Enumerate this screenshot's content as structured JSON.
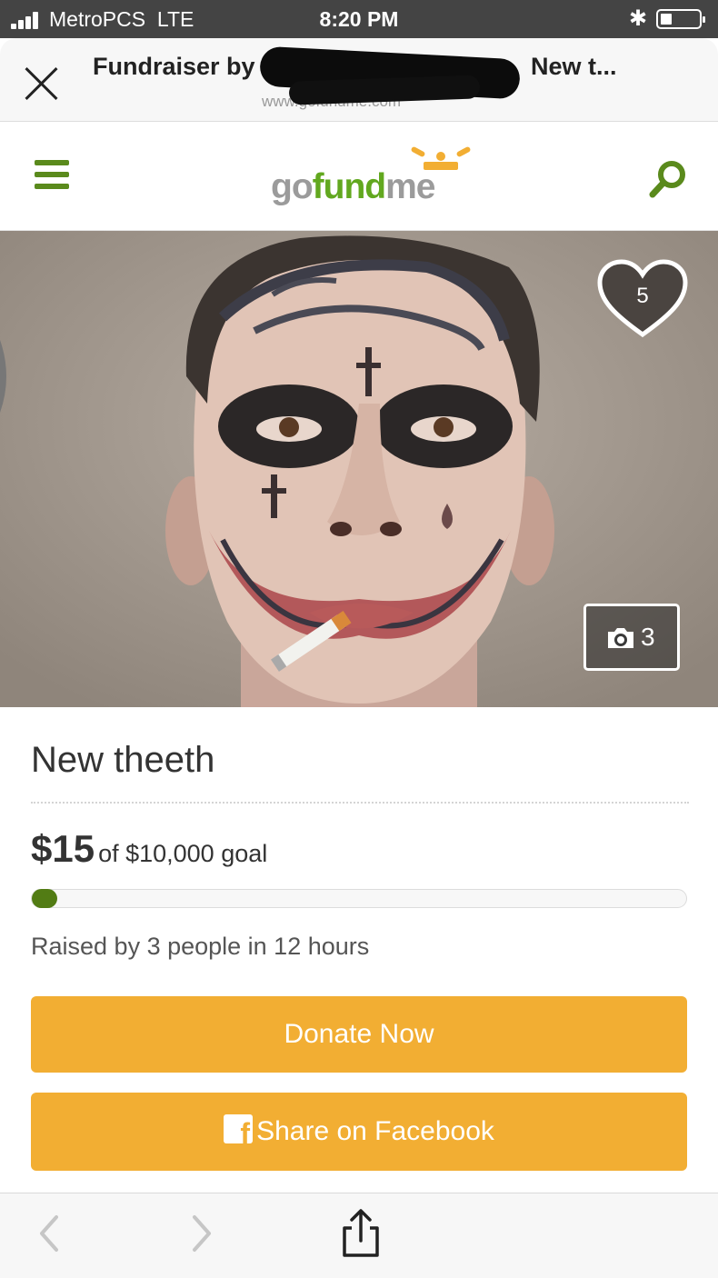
{
  "status_bar": {
    "carrier": "MetroPCS",
    "network": "LTE",
    "time": "8:20 PM"
  },
  "browser": {
    "title_start": "Fundraiser by",
    "title_end": "New t...",
    "url": "www.gofundme.com"
  },
  "header": {
    "logo_go": "go",
    "logo_fund": "fund",
    "logo_me": "me"
  },
  "hero": {
    "like_count": "5",
    "photo_count": "3"
  },
  "campaign": {
    "title": "New theeth",
    "raised": "$15",
    "goal_text": "of $10,000 goal",
    "progress_fraction": 0.0015,
    "raised_by": "Raised by 3 people in 12 hours"
  },
  "buttons": {
    "donate": "Donate Now",
    "share": "Share on Facebook"
  },
  "colors": {
    "accent_green": "#62a81f",
    "button_orange": "#f2ae33",
    "status_bar": "#444444"
  },
  "icons": {
    "close": "close-icon",
    "menu": "hamburger-menu-icon",
    "search": "search-icon",
    "heart": "heart-icon",
    "camera": "camera-icon",
    "facebook": "facebook-icon",
    "back": "chevron-left-icon",
    "forward": "chevron-right-icon",
    "share": "share-icon"
  }
}
